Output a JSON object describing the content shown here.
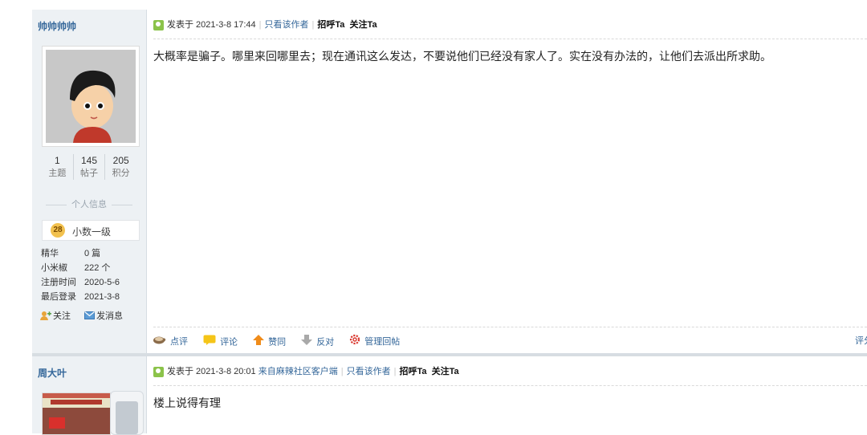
{
  "posts": [
    {
      "author": "帅帅帅帅",
      "stats": [
        {
          "num": "1",
          "label": "主题"
        },
        {
          "num": "145",
          "label": "帖子"
        },
        {
          "num": "205",
          "label": "积分"
        }
      ],
      "profile_section_title": "个人信息",
      "level": {
        "badge": "28",
        "label": "小数一级"
      },
      "info": [
        {
          "key": "精华",
          "value": "0 篇"
        },
        {
          "key": "小米椒",
          "value": "222 个"
        },
        {
          "key": "注册时间",
          "value": "2020-5-6"
        },
        {
          "key": "最后登录",
          "value": "2021-3-8"
        }
      ],
      "side_actions": {
        "follow": "关注",
        "message": "发消息"
      },
      "header": {
        "posted_at": "发表于 2021-3-8 17:44",
        "only_author": "只看该作者",
        "greet": "招呼Ta",
        "follow": "关注Ta"
      },
      "body": "大概率是骗子。哪里来回哪里去；现在通讯这么发达，不要说他们已经没有家人了。实在没有办法的，让他们去派出所求助。",
      "footer": {
        "comment_short": "点评",
        "comment": "评论",
        "upvote": "赞同",
        "downvote": "反对",
        "manage": "管理回帖",
        "rate": "评分"
      }
    },
    {
      "author": "周大叶",
      "header": {
        "posted_at": "发表于 2021-3-8 20:01",
        "from_client": "来自麻辣社区客户端",
        "only_author": "只看该作者",
        "greet": "招呼Ta",
        "follow": "关注Ta"
      },
      "body": "楼上说得有理"
    }
  ],
  "colors": {
    "link": "#336699",
    "sidebar_bg": "#edf1f4",
    "level_badge": "#f2c14e",
    "online_icon": "#8bc34a"
  }
}
